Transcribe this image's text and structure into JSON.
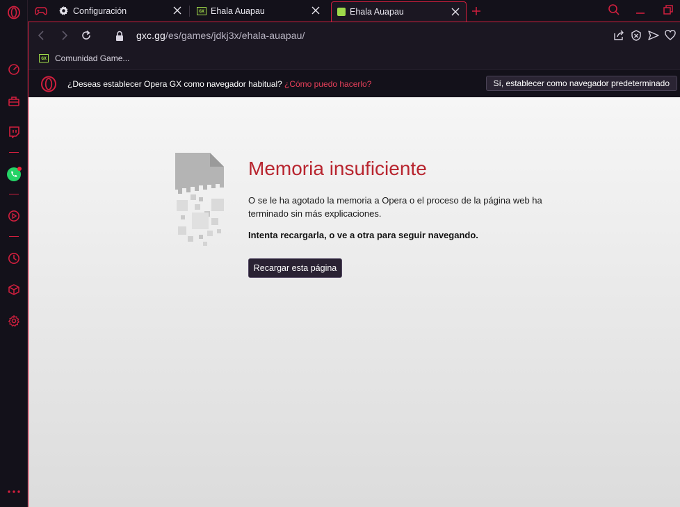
{
  "tabs": [
    {
      "label": "Configuración",
      "icon": "gear-icon"
    },
    {
      "label": "Ehala Auapau",
      "icon": "gx-games-icon"
    },
    {
      "label": "Ehala Auapau",
      "icon": "gx-games-icon",
      "active": true
    }
  ],
  "address": {
    "host": "gxc.gg",
    "path": "/es/games/jdkj3x/ehala-auapau/"
  },
  "bookmarks": [
    {
      "label": "Comunidad Game...",
      "icon": "gx-games-icon"
    }
  ],
  "infobar": {
    "question": "¿Deseas establecer Opera GX como navegador habitual?",
    "link": "¿Cómo puedo hacerlo?",
    "button": "Sí, establecer como navegador predeterminado"
  },
  "error": {
    "title": "Memoria insuficiente",
    "description": "O se le ha agotado la memoria a Opera o el proceso de la página web ha terminado sin más explicaciones.",
    "hint": "Intenta recargarla, o ve a otra para seguir navegando.",
    "reload_button": "Recargar esta página"
  },
  "colors": {
    "accent": "#d11f3e",
    "error_title": "#b8252f",
    "background": "#13111a"
  }
}
